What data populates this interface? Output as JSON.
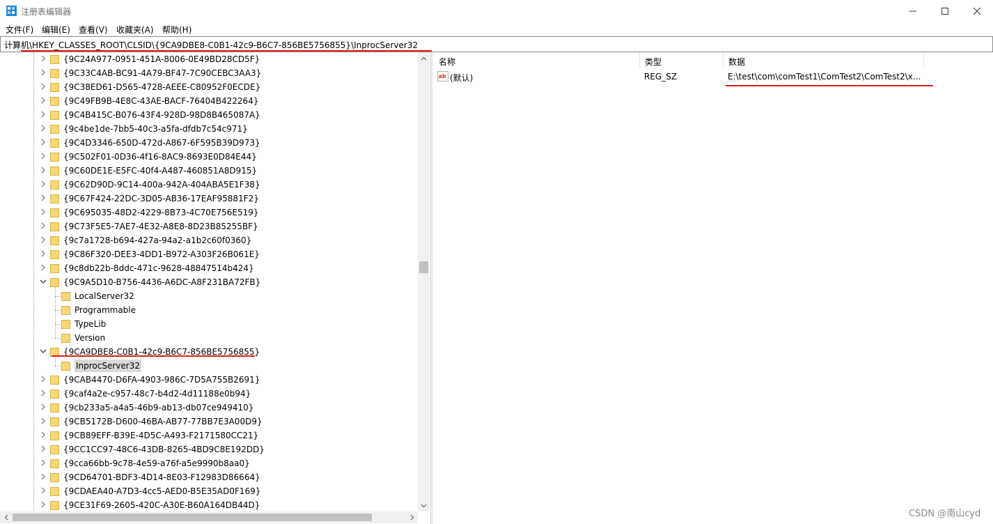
{
  "window": {
    "title": "注册表编辑器",
    "controls": {
      "minimize": "—",
      "maximize": "☐",
      "close": "✕"
    }
  },
  "menu": [
    "文件(F)",
    "编辑(E)",
    "查看(V)",
    "收藏夹(A)",
    "帮助(H)"
  ],
  "address": "计算机\\HKEY_CLASSES_ROOT\\CLSID\\{9CA9DBE8-C0B1-42c9-B6C7-856BE5756855}\\InprocServer32",
  "tree": [
    {
      "label": "{9C24A977-0951-451A-8006-0E49BD28CD5F}",
      "level": 1,
      "state": "collapsed"
    },
    {
      "label": "{9C33C4AB-BC91-4A79-BF47-7C90CEBC3AA3}",
      "level": 1,
      "state": "collapsed"
    },
    {
      "label": "{9C38ED61-D565-4728-AEEE-C80952F0ECDE}",
      "level": 1,
      "state": "collapsed"
    },
    {
      "label": "{9C49FB9B-4E8C-43AE-BACF-76404B422264}",
      "level": 1,
      "state": "collapsed"
    },
    {
      "label": "{9C4B415C-B076-43F4-928D-98D8B465087A}",
      "level": 1,
      "state": "collapsed"
    },
    {
      "label": "{9c4be1de-7bb5-40c3-a5fa-dfdb7c54c971}",
      "level": 1,
      "state": "collapsed"
    },
    {
      "label": "{9C4D3346-650D-472d-A867-6F595B39D973}",
      "level": 1,
      "state": "collapsed"
    },
    {
      "label": "{9C502F01-0D36-4f16-8AC9-8693E0D84E44}",
      "level": 1,
      "state": "collapsed"
    },
    {
      "label": "{9C60DE1E-E5FC-40f4-A487-460851A8D915}",
      "level": 1,
      "state": "collapsed"
    },
    {
      "label": "{9C62D90D-9C14-400a-942A-404ABA5E1F38}",
      "level": 1,
      "state": "collapsed"
    },
    {
      "label": "{9C67F424-22DC-3D05-AB36-17EAF95881F2}",
      "level": 1,
      "state": "collapsed"
    },
    {
      "label": "{9C695035-48D2-4229-8B73-4C70E756E519}",
      "level": 1,
      "state": "collapsed"
    },
    {
      "label": "{9C73F5E5-7AE7-4E32-A8E8-8D23B85255BF}",
      "level": 1,
      "state": "collapsed"
    },
    {
      "label": "{9c7a1728-b694-427a-94a2-a1b2c60f0360}",
      "level": 1,
      "state": "collapsed"
    },
    {
      "label": "{9C86F320-DEE3-4DD1-B972-A303F26B061E}",
      "level": 1,
      "state": "collapsed"
    },
    {
      "label": "{9c8db22b-8ddc-471c-9628-48847514b424}",
      "level": 1,
      "state": "collapsed"
    },
    {
      "label": "{9C9A5D10-B756-4436-A6DC-A8F231BA72FB}",
      "level": 1,
      "state": "expanded"
    },
    {
      "label": "LocalServer32",
      "level": 2,
      "state": "leaf"
    },
    {
      "label": "Programmable",
      "level": 2,
      "state": "leaf"
    },
    {
      "label": "TypeLib",
      "level": 2,
      "state": "leaf"
    },
    {
      "label": "Version",
      "level": 2,
      "state": "leaf"
    },
    {
      "label": "{9CA9DBE8-C0B1-42c9-B6C7-856BE5756855}",
      "level": 1,
      "state": "expanded"
    },
    {
      "label": "InprocServer32",
      "level": 2,
      "state": "leaf",
      "selected": true
    },
    {
      "label": "{9CAB4470-D6FA-4903-986C-7D5A755B2691}",
      "level": 1,
      "state": "collapsed"
    },
    {
      "label": "{9caf4a2e-c957-48c7-b4d2-4d11188e0b94}",
      "level": 1,
      "state": "collapsed"
    },
    {
      "label": "{9cb233a5-a4a5-46b9-ab13-db07ce949410}",
      "level": 1,
      "state": "collapsed"
    },
    {
      "label": "{9CB5172B-D600-46BA-AB77-77BB7E3A00D9}",
      "level": 1,
      "state": "collapsed"
    },
    {
      "label": "{9CB89EFF-B39E-4D5C-A493-F2171580CC21}",
      "level": 1,
      "state": "collapsed"
    },
    {
      "label": "{9CC1CC97-48C6-43DB-8265-4BD9C8E192DD}",
      "level": 1,
      "state": "collapsed"
    },
    {
      "label": "{9cca66bb-9c78-4e59-a76f-a5e9990b8aa0}",
      "level": 1,
      "state": "collapsed"
    },
    {
      "label": "{9CD64701-BDF3-4D14-8E03-F12983D86664}",
      "level": 1,
      "state": "collapsed"
    },
    {
      "label": "{9CDAEA40-A7D3-4cc5-AED0-B5E35AD0F169}",
      "level": 1,
      "state": "collapsed"
    },
    {
      "label": "{9CE31F69-2605-420C-A30E-B60A164DB44D}",
      "level": 1,
      "state": "collapsed"
    }
  ],
  "values": {
    "columns": [
      "名称",
      "类型",
      "数据"
    ],
    "rows": [
      {
        "name": "(默认)",
        "type": "REG_SZ",
        "data": "E:\\test\\com\\comTest1\\ComTest2\\ComTest2\\x..."
      }
    ]
  },
  "watermark": "CSDN @南山cyd",
  "colors": {
    "annotation_red": "#e31c1c",
    "folder_yellow": "#f8d775",
    "selected_bg": "#d9d9d9"
  }
}
